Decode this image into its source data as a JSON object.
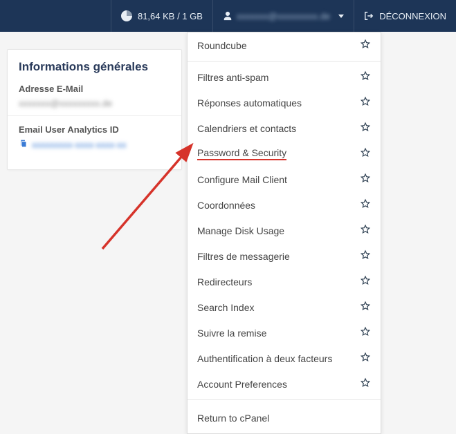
{
  "topbar": {
    "disk_usage": "81,64 KB / 1 GB",
    "account_email": "xxxxxxx@xxxxxxxxx.de",
    "logout_label": "DÉCONNEXION"
  },
  "panel": {
    "title": "Informations générales",
    "email_label": "Adresse E-Mail",
    "email_value": "xxxxxxx@xxxxxxxxx.de",
    "analytics_label": "Email User Analytics ID",
    "analytics_value": "xxxxxxxxx-xxxx-xxxx-xx"
  },
  "dropdown": {
    "items_top": [
      {
        "label": "Roundcube"
      }
    ],
    "items_main": [
      {
        "label": "Filtres anti-spam"
      },
      {
        "label": "Réponses automatiques"
      },
      {
        "label": "Calendriers et contacts"
      },
      {
        "label": "Password & Security",
        "highlighted": true
      },
      {
        "label": "Configure Mail Client"
      },
      {
        "label": "Coordonnées"
      },
      {
        "label": "Manage Disk Usage"
      },
      {
        "label": "Filtres de messagerie"
      },
      {
        "label": "Redirecteurs"
      },
      {
        "label": "Search Index"
      },
      {
        "label": "Suivre la remise"
      },
      {
        "label": "Authentification à deux facteurs"
      },
      {
        "label": "Account Preferences"
      }
    ],
    "return_label": "Return to cPanel"
  },
  "annotation": {
    "arrow_color": "#d6332a"
  }
}
